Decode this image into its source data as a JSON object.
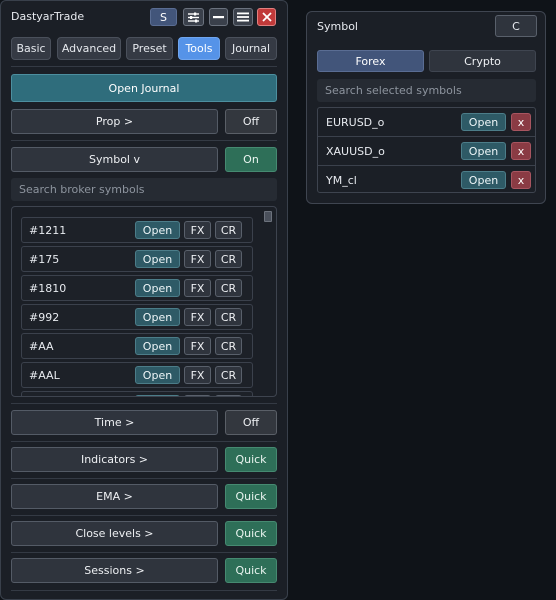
{
  "app": {
    "title": "DastyarTrade",
    "s_label": "S",
    "header_icons": [
      "sliders-icon",
      "minimize-icon",
      "menu-icon",
      "close-icon"
    ]
  },
  "tabs": [
    {
      "label": "Basic",
      "active": false
    },
    {
      "label": "Advanced",
      "active": false
    },
    {
      "label": "Preset",
      "active": false
    },
    {
      "label": "Tools",
      "active": true
    },
    {
      "label": "Journal",
      "active": false
    }
  ],
  "main": {
    "open_journal": "Open Journal",
    "prop": {
      "label": "Prop  >",
      "toggle": "Off"
    },
    "symbol": {
      "label": "Symbol  v",
      "toggle": "On"
    },
    "search_placeholder": "Search broker symbols",
    "symbols": [
      {
        "name": "#1211"
      },
      {
        "name": "#175"
      },
      {
        "name": "#1810"
      },
      {
        "name": "#992"
      },
      {
        "name": "#AA"
      },
      {
        "name": "#AAL"
      },
      {
        "name": ""
      }
    ],
    "row_buttons": {
      "open": "Open",
      "fx": "FX",
      "cr": "CR"
    },
    "time": {
      "label": "Time  >",
      "toggle": "Off"
    },
    "indicators": {
      "label": "Indicators  >",
      "action": "Quick"
    },
    "ema": {
      "label": "EMA  >",
      "action": "Quick"
    },
    "close_levels": {
      "label": "Close levels  >",
      "action": "Quick"
    },
    "sessions": {
      "label": "Sessions  >",
      "action": "Quick"
    }
  },
  "symbol_panel": {
    "title": "Symbol",
    "c_label": "C",
    "tabs": [
      {
        "label": "Forex",
        "active": true
      },
      {
        "label": "Crypto",
        "active": false
      }
    ],
    "search_placeholder": "Search selected symbols",
    "items": [
      {
        "name": "EURUSD_o"
      },
      {
        "name": "XAUUSD_o"
      },
      {
        "name": "YM_cl"
      }
    ],
    "open_label": "Open",
    "remove_label": "x"
  },
  "colors": {
    "panel_bg": "#1b1f26",
    "accent_blue": "#5593e8",
    "teal": "#2f6d7c",
    "green": "#2e6f58",
    "close_red": "#c13a3a"
  }
}
